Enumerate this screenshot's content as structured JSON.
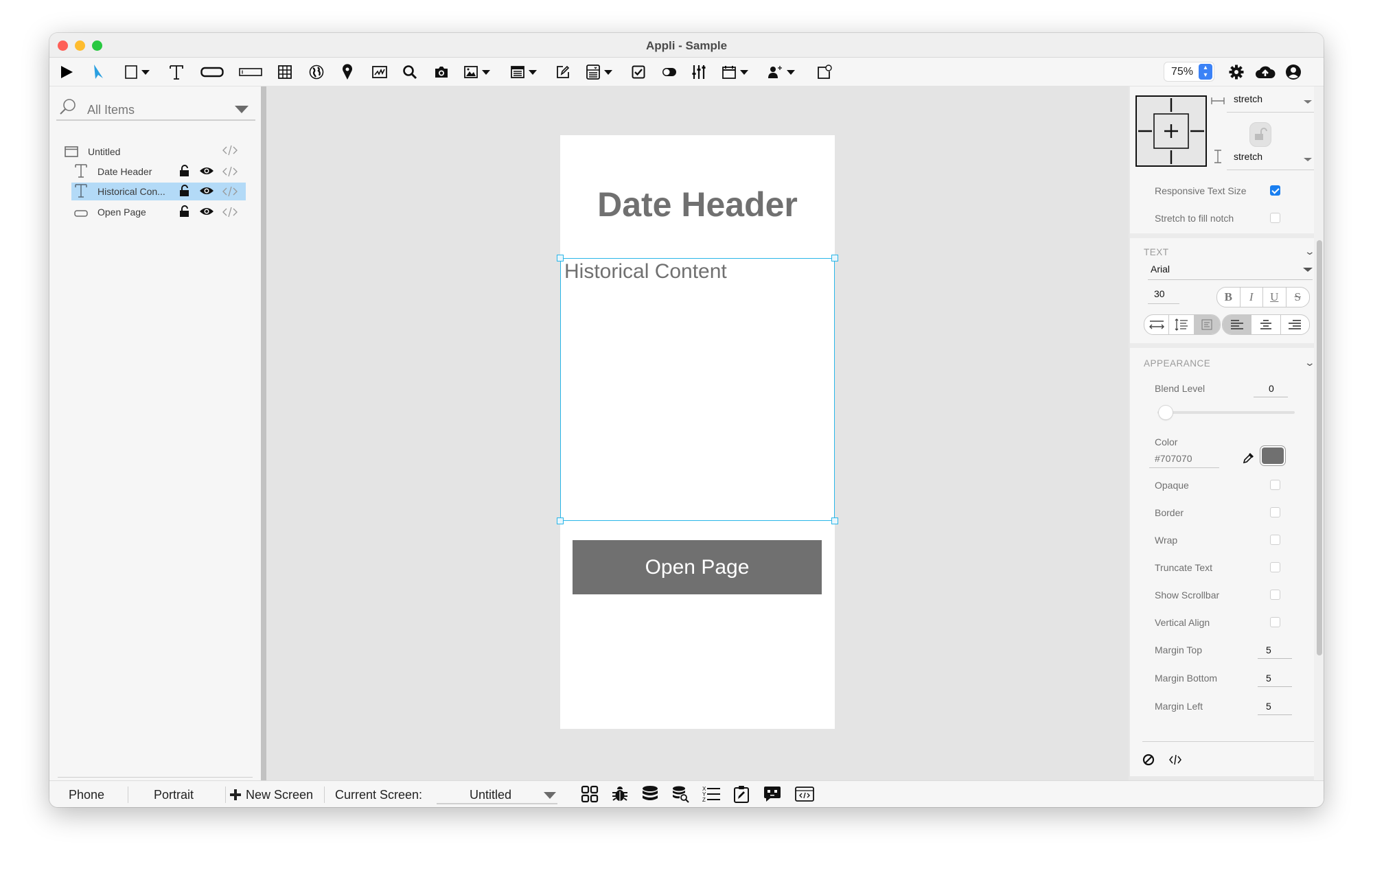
{
  "window": {
    "title": "Appli - Sample"
  },
  "toolbar": {
    "tools": [
      {
        "name": "run",
        "icon": "play-icon"
      },
      {
        "name": "select",
        "icon": "pointer-arrow-icon",
        "active": true
      },
      {
        "name": "shape",
        "icon": "rectangle-icon",
        "dropdown": true
      },
      {
        "name": "text",
        "icon": "text-t-icon"
      },
      {
        "name": "button",
        "icon": "button-shape-icon"
      },
      {
        "name": "text-field",
        "icon": "text-field-icon"
      },
      {
        "name": "table",
        "icon": "grid-table-icon"
      },
      {
        "name": "web",
        "icon": "globe-icon"
      },
      {
        "name": "map",
        "icon": "map-pin-icon"
      },
      {
        "name": "chart",
        "icon": "chart-icon"
      },
      {
        "name": "search",
        "icon": "search-icon"
      },
      {
        "name": "camera",
        "icon": "camera-icon"
      },
      {
        "name": "image",
        "icon": "image-icon",
        "dropdown": true
      },
      {
        "name": "list",
        "icon": "list-icon",
        "dropdown": true
      },
      {
        "name": "edit",
        "icon": "edit-pencil-icon"
      },
      {
        "name": "picker",
        "icon": "picker-icon",
        "dropdown": true
      },
      {
        "name": "checkbox",
        "icon": "checkbox-icon"
      },
      {
        "name": "toggle",
        "icon": "toggle-icon"
      },
      {
        "name": "slider",
        "icon": "sliders-icon"
      },
      {
        "name": "date",
        "icon": "calendar-icon",
        "dropdown": true
      },
      {
        "name": "contacts",
        "icon": "add-user-icon",
        "dropdown": true
      },
      {
        "name": "notification",
        "icon": "badge-icon"
      }
    ],
    "zoom_level": "75%",
    "right_icons": [
      "gear-icon",
      "cloud-upload-icon",
      "user-account-icon"
    ]
  },
  "sidebar": {
    "filter_label": "All Items",
    "layers": [
      {
        "label": "Untitled",
        "icon": "screen-icon",
        "indent": 0,
        "selected": false,
        "lock": false,
        "eye": false
      },
      {
        "label": "Date Header",
        "icon": "text-t-icon",
        "indent": 1,
        "selected": false,
        "lock": true,
        "eye": true
      },
      {
        "label": "Historical Con...",
        "icon": "text-t-icon",
        "indent": 1,
        "selected": true,
        "lock": true,
        "eye": true
      },
      {
        "label": "Open Page",
        "icon": "button-shape-icon",
        "indent": 1,
        "selected": false,
        "lock": true,
        "eye": true
      }
    ],
    "bottom_icons": [
      "layers-list-icon",
      "bookmark-icon"
    ]
  },
  "canvas": {
    "date_header": "Date Header",
    "historical_content": "Historical Content",
    "open_page_button": "Open Page"
  },
  "properties": {
    "horizontal_sizing": "stretch",
    "vertical_sizing": "stretch",
    "responsive_text_size": {
      "label": "Responsive Text Size",
      "checked": true
    },
    "stretch_to_fill_notch": {
      "label": "Stretch to fill notch",
      "checked": false
    },
    "text_section": {
      "title": "TEXT",
      "font": "Arial",
      "font_size": "30",
      "style_buttons": [
        "B",
        "I",
        "U",
        "S"
      ],
      "alignment": "left"
    },
    "appearance_section": {
      "title": "APPEARANCE",
      "blend_level_label": "Blend Level",
      "blend_level": "0",
      "color_label": "Color",
      "color_value": "#707070",
      "checkboxes": [
        {
          "label": "Opaque",
          "checked": false
        },
        {
          "label": "Border",
          "checked": false
        },
        {
          "label": "Wrap",
          "checked": false
        },
        {
          "label": "Truncate Text",
          "checked": false
        },
        {
          "label": "Show Scrollbar",
          "checked": false
        },
        {
          "label": "Vertical Align",
          "checked": false
        }
      ],
      "margins": [
        {
          "label": "Margin Top",
          "value": "5"
        },
        {
          "label": "Margin Bottom",
          "value": "5"
        },
        {
          "label": "Margin Left",
          "value": "5"
        }
      ]
    },
    "footer_icons": [
      "disable-icon",
      "code-icon"
    ]
  },
  "statusbar": {
    "device": "Phone",
    "orientation": "Portrait",
    "new_screen": "New Screen",
    "current_screen_label": "Current Screen:",
    "current_screen": "Untitled",
    "icons": [
      "screens-grid-icon",
      "bug-icon",
      "database-icon",
      "database-search-icon",
      "xyz-list-icon",
      "clipboard-edit-icon",
      "chat-bot-icon",
      "web-code-icon"
    ]
  },
  "colors": {
    "accent": "#29b6e8",
    "selection_row": "#b3daf7",
    "element_color": "#707070",
    "checkbox_on": "#1a7ff0"
  }
}
